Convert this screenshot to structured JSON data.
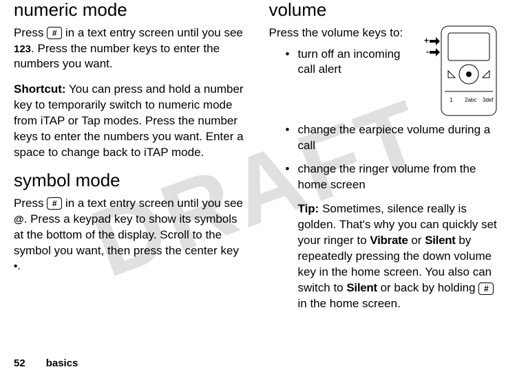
{
  "watermark": "DRAFT",
  "left": {
    "h_numeric": "numeric mode",
    "numeric_p1a": "Press ",
    "key_hash": "#",
    "numeric_p1b": " in a text entry screen until you see ",
    "icon_123": "123",
    "numeric_p1c": ". Press the number keys to enter the numbers you want.",
    "shortcut_label": "Shortcut:",
    "shortcut_body": " You can press and hold a number key to temporarily switch to numeric mode from iTAP or Tap modes. Press the number keys to enter the numbers you want. Enter a space to change back to iTAP mode.",
    "h_symbol": "symbol mode",
    "symbol_p1a": "Press ",
    "symbol_p1b": " in a text entry screen until you see ",
    "icon_at": "@",
    "symbol_p1c": ". Press a keypad key to show its symbols at the bottom of the display. Scroll to the symbol you want, then press the center key ",
    "center_dot": "•",
    "symbol_p1d": "."
  },
  "right": {
    "h_volume": "volume",
    "vol_intro": "Press the volume keys to:",
    "bullets": {
      "b1": "turn off an incoming call alert",
      "b2": "change the earpiece volume during a call",
      "b3": "change the ringer volume from the home screen"
    },
    "tip_label": "Tip:",
    "tip_a": " Sometimes, silence really is golden. That's why you can quickly set your ringer to ",
    "tip_vibrate": "Vibrate",
    "tip_b": " or ",
    "tip_silent": "Silent",
    "tip_c": " by repeatedly pressing the down volume key in the home screen. You also can switch to ",
    "tip_silent2": "Silent",
    "tip_d": " or back by holding ",
    "tip_e": " in the home screen."
  },
  "footer": {
    "page": "52",
    "section": "basics"
  }
}
